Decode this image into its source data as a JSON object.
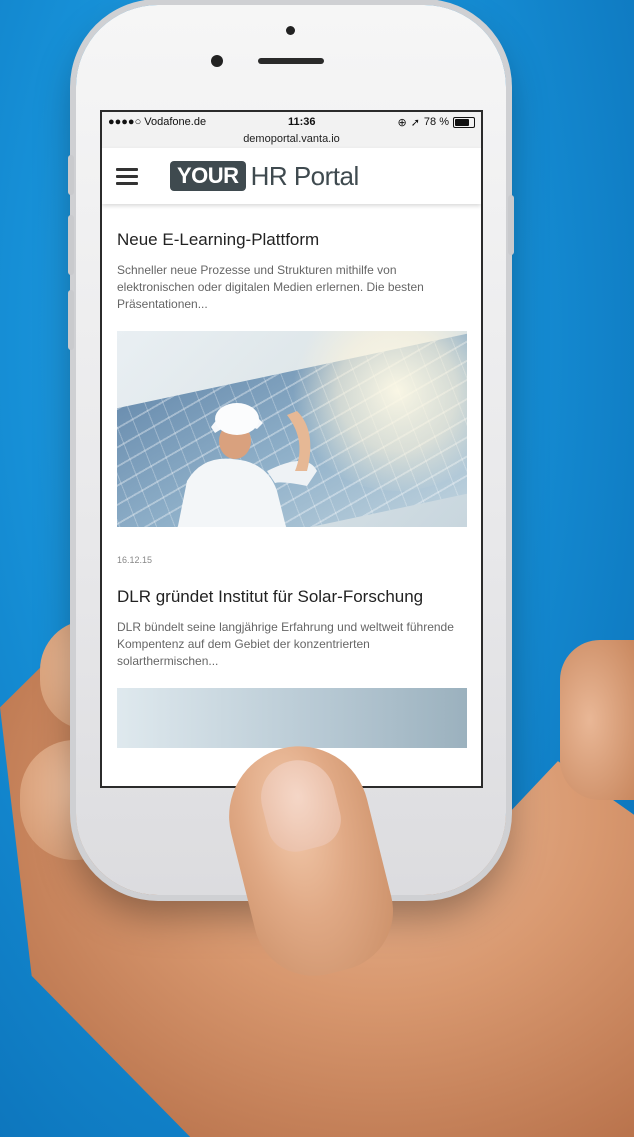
{
  "status_bar": {
    "carrier": "●●●●○ Vodafone.de",
    "time": "11:36",
    "battery": "78 %",
    "battery_level": 0.78,
    "url": "demoportal.vanta.io"
  },
  "header": {
    "logo_box": "YOUR",
    "logo_text": "HR Portal"
  },
  "articles": [
    {
      "title": "Neue E-Learning-Plattform",
      "description": "Schneller neue Prozesse und Strukturen mithilfe von elektronischen oder digitalen Medien erlernen. Die besten Präsentationen...",
      "date": "16.12.15"
    },
    {
      "title": "DLR gründet Institut für Solar-Forschung",
      "description": "DLR bündelt seine langjährige Erfahrung und weltweit führende Kompentenz auf dem Gebiet der konzentrierten solarthermischen..."
    }
  ],
  "colors": {
    "background": "#168fd6",
    "logo": "#3f4a4f"
  }
}
